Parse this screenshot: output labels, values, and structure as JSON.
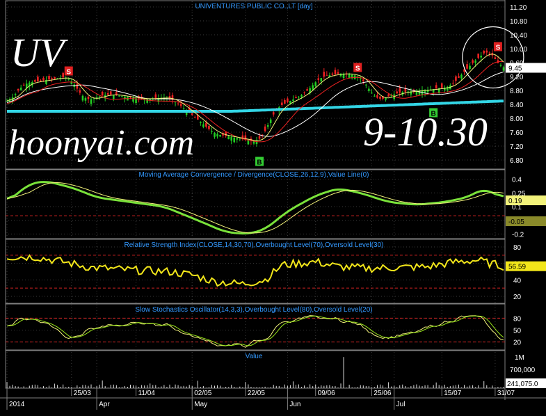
{
  "overlay": {
    "ticker": "UV",
    "site": "hoonyai.com",
    "target": "9-10.30"
  },
  "colors": {
    "up": "#22cc22",
    "down": "#ee2222",
    "ma_long": "#33d6e6",
    "ma_mid": "#ffffff",
    "ma_red": "#ee2222",
    "macd": "#7ae23a",
    "signal": "#f2f27a",
    "rsi": "#f2e61a",
    "stoch_k": "#f2f27a",
    "stoch_d": "#99e61a",
    "axis_text": "#ffffff",
    "panel_title": "#3399ff",
    "grid": "#3a3a3a",
    "level": "#cc2222",
    "volume": "#dddddd",
    "sell": "#e02020",
    "buy": "#33cc33"
  },
  "chart_data": [
    {
      "panel": "price",
      "type": "candlestick",
      "title": "UNIVENTURES PUBLIC CO.,LT [day]",
      "ylim": [
        6.6,
        11.4
      ],
      "y_ticks": [
        "11.20",
        "10.80",
        "10.40",
        "10.00",
        "9.60",
        "9.20",
        "8.80",
        "8.40",
        "8.00",
        "7.60",
        "7.20",
        "6.80"
      ],
      "last_value": "9.45",
      "signals": [
        {
          "label": "S",
          "day": 22,
          "price": 9.35
        },
        {
          "label": "B",
          "day": 90,
          "price": 6.75
        },
        {
          "label": "S",
          "day": 125,
          "price": 9.45
        },
        {
          "label": "B",
          "day": 152,
          "price": 8.15
        },
        {
          "label": "S",
          "day": 175,
          "price": 10.05
        }
      ],
      "highlight_circle_day": 174
    },
    {
      "panel": "macd",
      "type": "line",
      "title": "Moving Average Convergence / Divergence(CLOSE,26,12,9),Value Line(0)",
      "ylim": [
        -0.25,
        0.45
      ],
      "y_ticks": [
        "0.4",
        "0.25",
        "0.1",
        "-0.05",
        "-0.2"
      ],
      "last_values": [
        "0.19",
        "-0.05"
      ]
    },
    {
      "panel": "rsi",
      "type": "line",
      "title": "Relative Strength Index(CLOSE,14,30,70),Overbought Level(70),Oversold Level(30)",
      "ylim": [
        15,
        90
      ],
      "y_ticks": [
        "80",
        "60",
        "40",
        "20"
      ],
      "levels": [
        70,
        30
      ],
      "last_value": "56.59"
    },
    {
      "panel": "stoch",
      "type": "line",
      "title": "Slow Stochastics Oscillator(14,3,3),Overbought Level(80),Oversold Level(20)",
      "ylim": [
        0,
        100
      ],
      "y_ticks": [
        "80",
        "50",
        "20"
      ],
      "levels": [
        80,
        20
      ]
    },
    {
      "panel": "volume",
      "type": "bar",
      "title": "Value",
      "y_ticks": [
        "1M",
        "700,000"
      ],
      "last_value": "241,075.0"
    }
  ],
  "x_axis": {
    "labels": [
      {
        "text": "2014",
        "day": 0
      },
      {
        "text": "25/03",
        "day": 23
      },
      {
        "text": "Apr",
        "day": 32
      },
      {
        "text": "11/04",
        "day": 46
      },
      {
        "text": "02/05",
        "day": 66
      },
      {
        "text": "May",
        "day": 66
      },
      {
        "text": "22/05",
        "day": 85
      },
      {
        "text": "Jun",
        "day": 100
      },
      {
        "text": "09/06",
        "day": 110
      },
      {
        "text": "25/06",
        "day": 130
      },
      {
        "text": "Jul",
        "day": 138
      },
      {
        "text": "15/07",
        "day": 155
      },
      {
        "text": "31/07",
        "day": 174
      }
    ]
  }
}
